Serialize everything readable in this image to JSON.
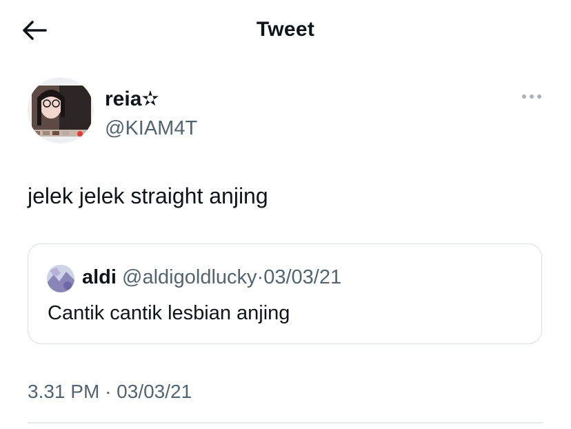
{
  "header": {
    "title": "Tweet",
    "back_icon": "arrow-left-icon"
  },
  "tweet": {
    "author": {
      "display_name": "reia✫",
      "handle": "@KIAM4T"
    },
    "more_icon": "more-horizontal-icon",
    "text": "jelek jelek straight anjing",
    "time": "3.31 PM",
    "separator": "·",
    "date": "03/03/21"
  },
  "quoted_tweet": {
    "display_name": "aldi",
    "handle": "@aldigoldlucky",
    "separator": "·",
    "date": "03/03/21",
    "text": "Cantik cantik lesbian anjing"
  },
  "colors": {
    "text_primary": "#0f1419",
    "text_secondary": "#536471",
    "border": "#d8dee2"
  }
}
